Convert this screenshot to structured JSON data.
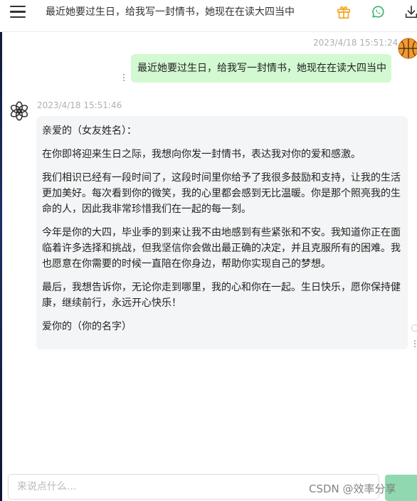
{
  "header": {
    "title": "最近她要过生日，给我写一封情书，她现在在读大四当中",
    "icons": [
      "menu-icon",
      "gift-icon",
      "whatsapp-icon",
      "download-icon"
    ],
    "accent_gift": "#f5a623",
    "accent_whatsapp": "#3cb371"
  },
  "messages": [
    {
      "role": "user",
      "time": "2023/4/18 15:51:24",
      "text": "最近她要过生日，给我写一封情书，她现在在读大四当中",
      "bubble_color": "#d2f9d1"
    },
    {
      "role": "assistant",
      "time": "2023/4/18 15:51:46",
      "paragraphs": [
        "亲爱的（女友姓名）：",
        "在你即将迎来生日之际，我想向你发一封情书，表达我对你的爱和感激。",
        "我们相识已经有一段时间了，这段时间里你给予了我很多鼓励和支持，让我的生活更加美好。每次看到你的微笑，我的心里都会感到无比温暖。你是那个照亮我的生命的人，因此我非常珍惜我们在一起的每一刻。",
        "今年是你的大四，毕业季的到来让我不由地感到有些紧张和不安。我知道你正在面临着许多选择和挑战，但我坚信你会做出最正确的决定，并且克服所有的困难。我也愿意在你需要的时候一直陪在你身边，帮助你实现自己的梦想。",
        "最后，我想告诉你，无论你走到哪里，我的心和你在一起。生日快乐，愿你保持健康，继续前行，永远开心快乐！",
        "爱你的（你的名字）"
      ],
      "bubble_color": "#f4f5f6"
    }
  ],
  "input": {
    "placeholder": "来说点什么...",
    "value": ""
  },
  "send_button": {
    "label": "",
    "color": "#90d9b0"
  },
  "watermark": "CSDN @效率分享"
}
